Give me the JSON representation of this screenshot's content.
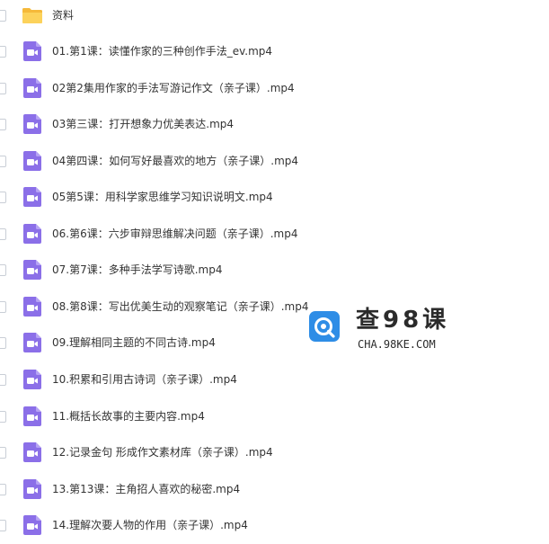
{
  "colors": {
    "folder": "#f7c64a",
    "video_icon": "#8b6fe8",
    "text": "#333333",
    "watermark_blue": "#2e8de6"
  },
  "files": [
    {
      "name": "资料",
      "icon": "folder-icon"
    },
    {
      "name": "01.第1课：读懂作家的三种创作手法_ev.mp4",
      "icon": "video-file-icon"
    },
    {
      "name": "02第2集用作家的手法写游记作文（亲子课）.mp4",
      "icon": "video-file-icon"
    },
    {
      "name": "03第三课：打开想象力优美表达.mp4",
      "icon": "video-file-icon"
    },
    {
      "name": "04第四课：如何写好最喜欢的地方（亲子课）.mp4",
      "icon": "video-file-icon"
    },
    {
      "name": "05第5课：用科学家思维学习知识说明文.mp4",
      "icon": "video-file-icon"
    },
    {
      "name": "06.第6课：六步审辩思维解决问题（亲子课）.mp4",
      "icon": "video-file-icon"
    },
    {
      "name": "07.第7课：多种手法学写诗歌.mp4",
      "icon": "video-file-icon"
    },
    {
      "name": "08.第8课：写出优美生动的观察笔记（亲子课）.mp4",
      "icon": "video-file-icon"
    },
    {
      "name": "09.理解相同主题的不同古诗.mp4",
      "icon": "video-file-icon"
    },
    {
      "name": "10.积累和引用古诗词（亲子课）.mp4",
      "icon": "video-file-icon"
    },
    {
      "name": "11.概括长故事的主要内容.mp4",
      "icon": "video-file-icon"
    },
    {
      "name": "12.记录金句 形成作文素材库（亲子课）.mp4",
      "icon": "video-file-icon"
    },
    {
      "name": "13.第13课：主角招人喜欢的秘密.mp4",
      "icon": "video-file-icon"
    },
    {
      "name": "14.理解次要人物的作用（亲子课）.mp4",
      "icon": "video-file-icon"
    }
  ],
  "watermark": {
    "title": "查98课",
    "url": "CHA.98KE.COM"
  }
}
